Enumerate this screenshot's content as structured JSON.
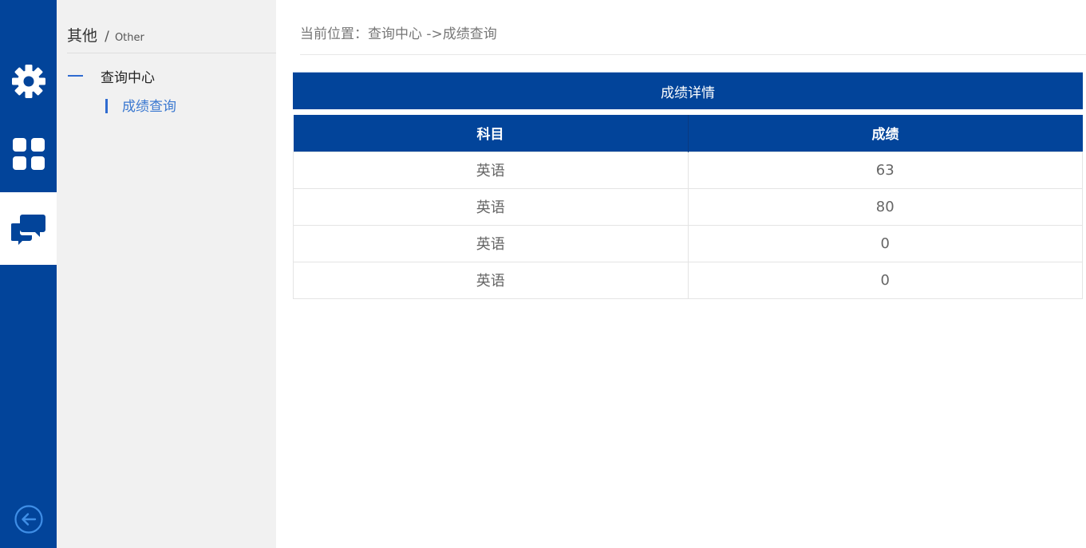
{
  "rail": {
    "items": [
      {
        "icon": "gear-icon"
      },
      {
        "icon": "grid-icon"
      },
      {
        "icon": "chat-icon",
        "active": true
      }
    ],
    "back_icon": "back-arrow-icon"
  },
  "subnav": {
    "title": "其他",
    "separator": "/",
    "subtitle": "Other",
    "group": {
      "label": "查询中心"
    },
    "item": {
      "label": "成绩查询"
    }
  },
  "breadcrumb": "当前位置：查询中心 ->成绩查询",
  "panel": {
    "title": "成绩详情"
  },
  "table": {
    "columns": [
      "科目",
      "成绩"
    ],
    "rows": [
      [
        "英语",
        "63"
      ],
      [
        "英语",
        "80"
      ],
      [
        "英语",
        "0"
      ],
      [
        "英语",
        "0"
      ]
    ]
  },
  "colors": {
    "primary": "#02449a",
    "accent": "#2f6bd0",
    "sidebar_bg": "#f1f1f1"
  }
}
